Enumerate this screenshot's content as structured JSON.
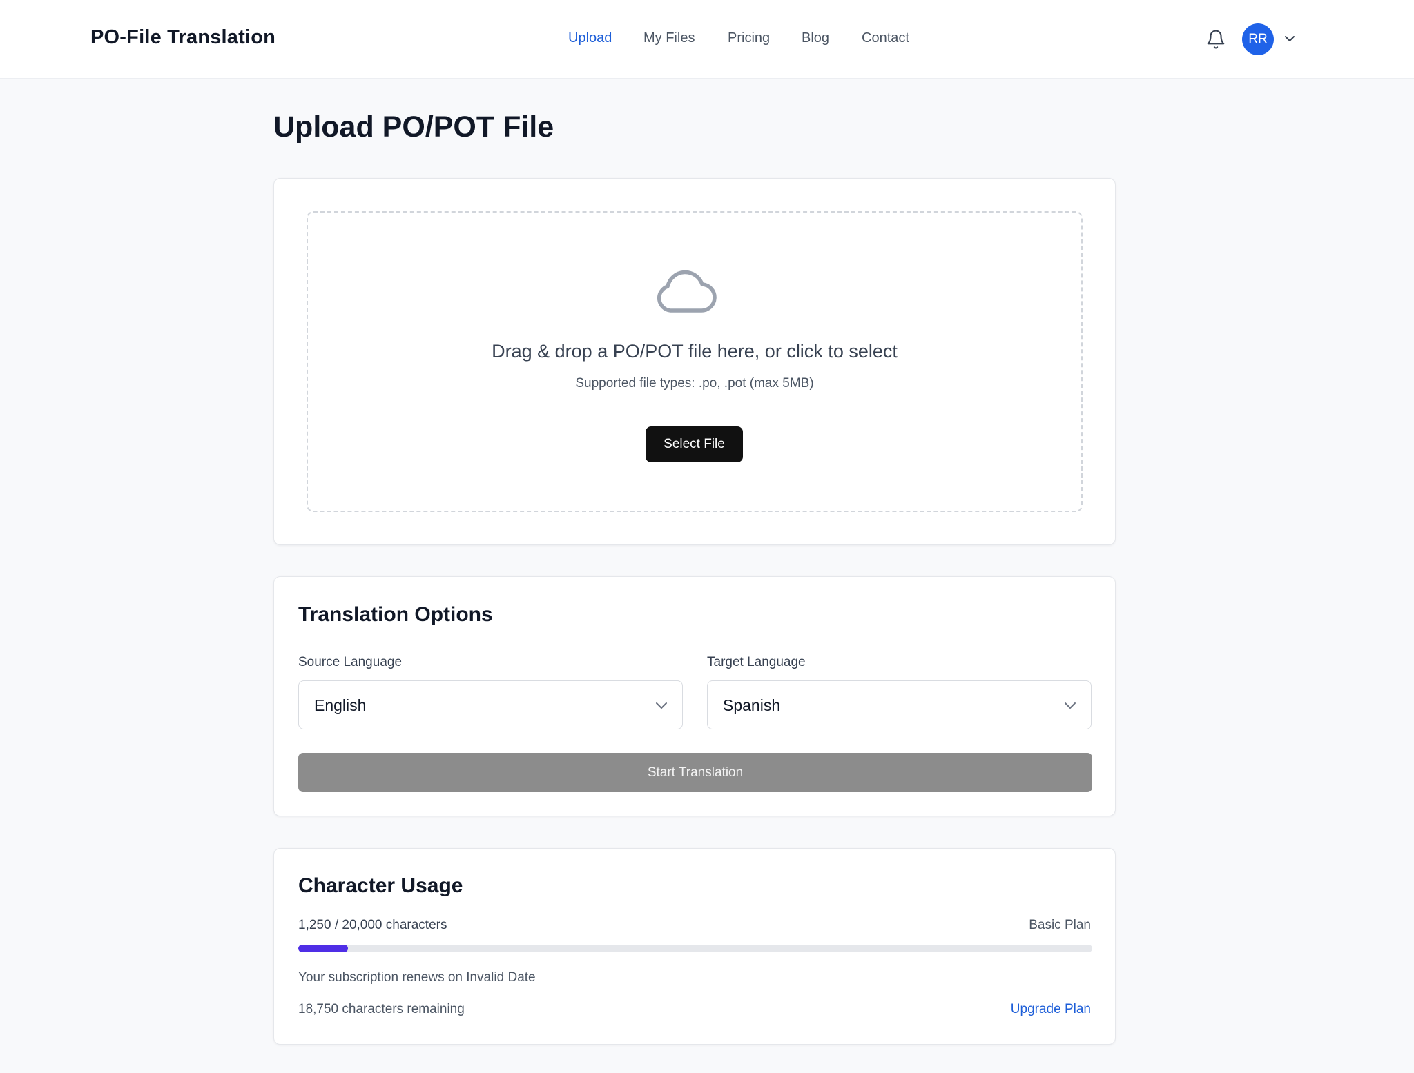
{
  "header": {
    "brand": "PO-File Translation",
    "nav": [
      {
        "label": "Upload",
        "active": true
      },
      {
        "label": "My Files",
        "active": false
      },
      {
        "label": "Pricing",
        "active": false
      },
      {
        "label": "Blog",
        "active": false
      },
      {
        "label": "Contact",
        "active": false
      }
    ],
    "avatar_initials": "RR",
    "icons": [
      "bell-icon",
      "chevron-down-icon"
    ]
  },
  "page": {
    "title": "Upload PO/POT File"
  },
  "upload": {
    "icon": "cloud-icon",
    "drop_title": "Drag & drop a PO/POT file here, or click to select",
    "drop_subtitle": "Supported file types: .po, .pot (max 5MB)",
    "select_button": "Select File"
  },
  "options": {
    "title": "Translation Options",
    "source_label": "Source Language",
    "source_value": "English",
    "target_label": "Target Language",
    "target_value": "Spanish",
    "start_button": "Start Translation",
    "start_disabled": true
  },
  "usage": {
    "title": "Character Usage",
    "count_text": "1,250 / 20,000 characters",
    "plan": "Basic Plan",
    "used": 1250,
    "limit": 20000,
    "renew_text": "Your subscription renews on Invalid Date",
    "remaining_text": "18,750 characters remaining",
    "upgrade_link": "Upgrade Plan"
  },
  "colors": {
    "accent": "#1d5ed8",
    "avatar": "#1f62e8",
    "progress": "#4f2ee6",
    "disabled_button": "#8c8c8c"
  }
}
